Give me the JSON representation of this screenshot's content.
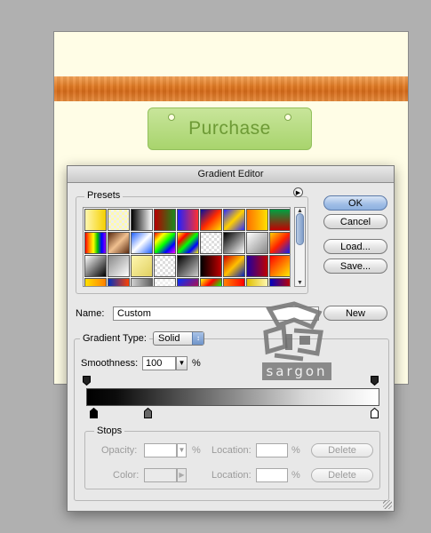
{
  "background": {
    "purchase_label": "Purchase"
  },
  "dialog": {
    "title": "Gradient Editor",
    "presets_label": "Presets",
    "buttons": {
      "ok": "OK",
      "cancel": "Cancel",
      "load": "Load...",
      "save": "Save...",
      "new": "New"
    },
    "name_label": "Name:",
    "name_value": "Custom",
    "gradient_type_label": "Gradient Type:",
    "gradient_type_value": "Solid",
    "smoothness_label": "Smoothness:",
    "smoothness_value": "100",
    "smoothness_unit": "%",
    "stops": {
      "legend": "Stops",
      "opacity_label": "Opacity:",
      "color_label": "Color:",
      "location_label": "Location:",
      "percent": "%",
      "delete_label": "Delete"
    }
  },
  "watermark": {
    "text": "sargon"
  },
  "colors": {
    "accent_blue": "#8eb1e0",
    "purchase_green": "#a8d46d",
    "wood_orange": "#e07a24"
  }
}
